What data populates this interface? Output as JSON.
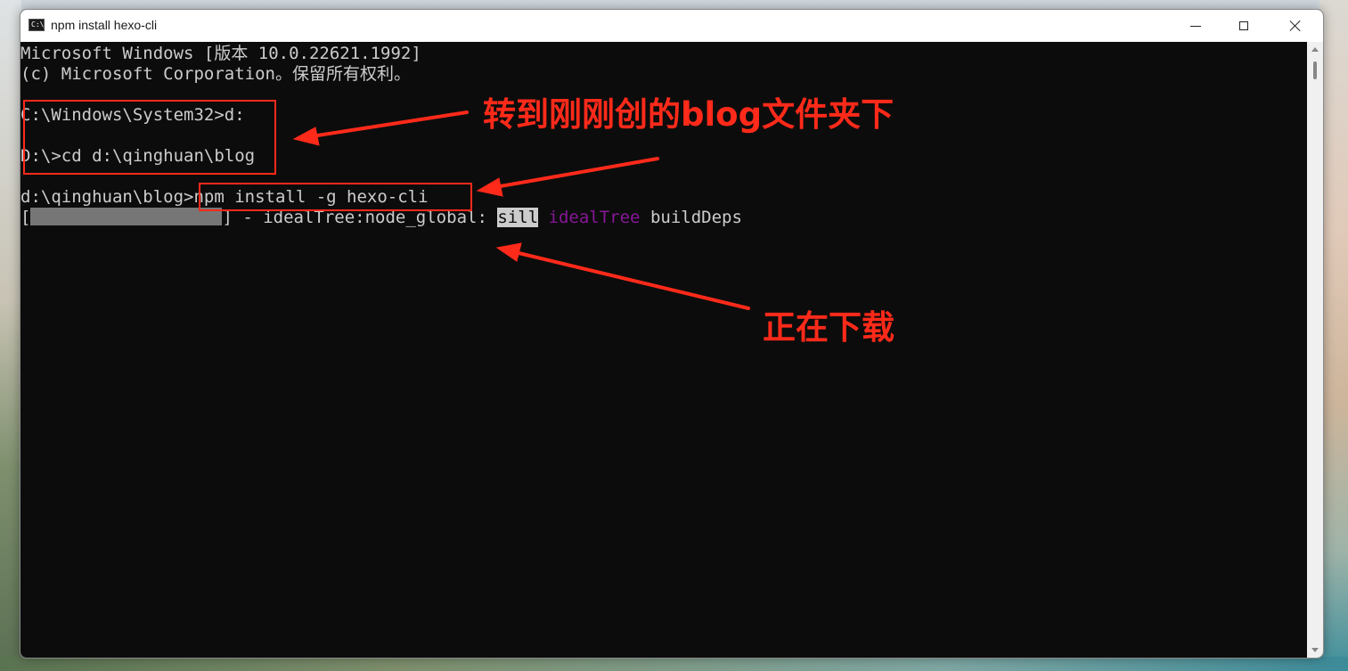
{
  "window": {
    "title": "npm install hexo-cli",
    "controls": {
      "minimize": "minimize",
      "maximize": "maximize",
      "close": "close"
    }
  },
  "console": {
    "lines": [
      "Microsoft Windows [版本 10.0.22621.1992]",
      "(c) Microsoft Corporation。保留所有权利。",
      "",
      "C:\\Windows\\System32>d:",
      "",
      "D:\\>cd d:\\qinghuan\\blog",
      "",
      "d:\\qinghuan\\blog>npm install -g hexo-cli"
    ],
    "progress": {
      "bracket_open": "[",
      "bracket_close": "]",
      "text": " - idealTree:node_global: ",
      "sill": "sill",
      "idealTree": "idealTree",
      "buildDeps": " buildDeps"
    }
  },
  "annotations": {
    "switch_folder": "转到刚刚创的blog文件夹下",
    "downloading": "正在下载"
  },
  "colors": {
    "console_bg": "#0c0c0c",
    "console_text": "#cccccc",
    "annotation": "#ff2a1a",
    "magenta": "#881798"
  }
}
